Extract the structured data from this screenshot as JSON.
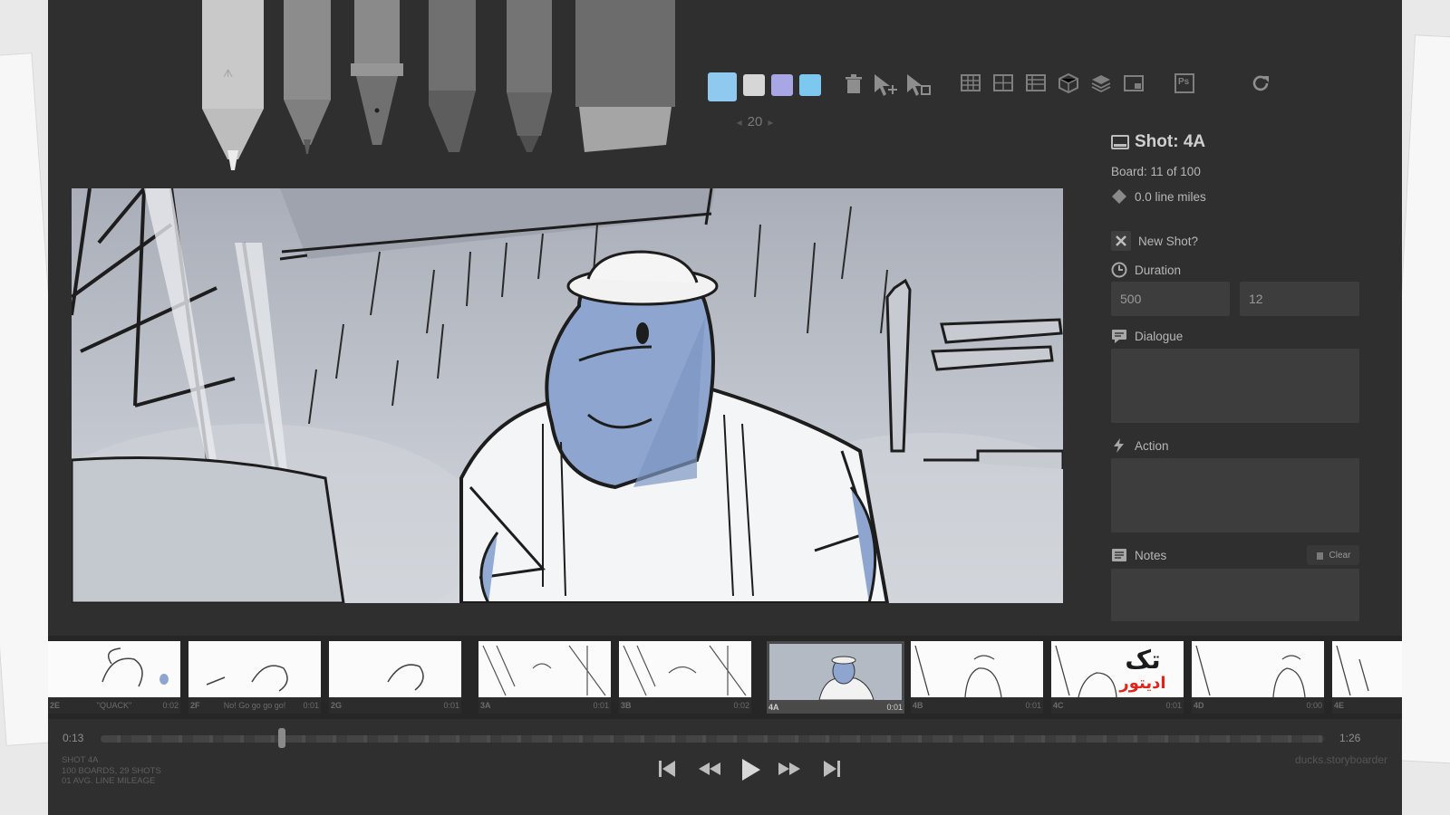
{
  "toolbar": {
    "colors": [
      "#8fc9f0",
      "#d6d6d6",
      "#a9a6e6",
      "#7cc8ef"
    ],
    "brush_size": "20",
    "icons": [
      "trash-icon",
      "select-move-icon",
      "select-copy-icon",
      "grid-3x3-icon",
      "grid-2x2-icon",
      "table-icon",
      "cube-icon",
      "layers-icon",
      "panel-icon",
      "photoshop-icon",
      "refresh-icon"
    ],
    "photoshop_label": "Ps"
  },
  "panel": {
    "shot_title": "Shot: 4A",
    "board_info": "Board: 11 of 100",
    "line_miles": "0.0 line miles",
    "new_shot_label": "New Shot?",
    "duration_label": "Duration",
    "duration_ms": "500",
    "duration_frames": "12",
    "dialogue_label": "Dialogue",
    "action_label": "Action",
    "notes_label": "Notes",
    "clear_label": "Clear"
  },
  "filmstrip": [
    {
      "id": "2E",
      "caption": "\"QUACK\"",
      "time": "0:02"
    },
    {
      "id": "2F",
      "caption": "No! Go go go go!",
      "time": "0:01"
    },
    {
      "id": "2G",
      "caption": "",
      "time": "0:01"
    },
    {
      "id": "3A",
      "caption": "",
      "time": "0:01"
    },
    {
      "id": "3B",
      "caption": "",
      "time": "0:02"
    },
    {
      "id": "4A",
      "caption": "",
      "time": "0:01",
      "selected": true
    },
    {
      "id": "4B",
      "caption": "",
      "time": "0:01"
    },
    {
      "id": "4C",
      "caption": "",
      "time": "0:01"
    },
    {
      "id": "4D",
      "caption": "",
      "time": "0:00"
    },
    {
      "id": "4E",
      "caption": "",
      "time": ""
    }
  ],
  "timeline": {
    "current": "0:13",
    "total": "1:26",
    "meta": [
      "SHOT 4A",
      "100 BOARDS, 29 SHOTS",
      "01 AVG. LINE MILEAGE"
    ],
    "filename": "ducks.storyboarder"
  },
  "watermark": {
    "line1": "تک",
    "line2": "ادیتور"
  }
}
